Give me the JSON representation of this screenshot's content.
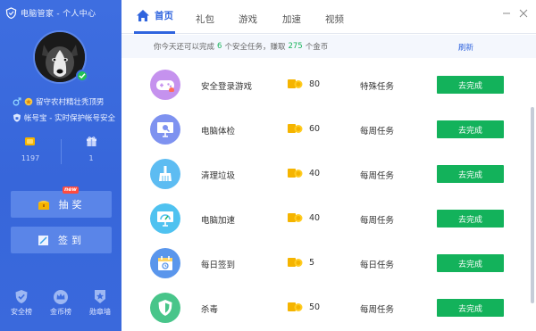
{
  "window": {
    "title": "电脑管家 - 个人中心"
  },
  "profile": {
    "nickname": "留守农村精壮秃顶男",
    "account_info": "帐号宝 - 实时保护帐号安全",
    "stats": [
      {
        "icon": "coin-stack-icon",
        "value": "1197"
      },
      {
        "icon": "gift-icon",
        "value": "1"
      }
    ],
    "lottery_label": "抽奖",
    "lottery_badge": "new",
    "checkin_label": "签到"
  },
  "bottom_nav": [
    {
      "icon": "shield-check-icon",
      "label": "安全榜"
    },
    {
      "icon": "crown-icon",
      "label": "金币榜"
    },
    {
      "icon": "medal-icon",
      "label": "勋章墙"
    }
  ],
  "tabs": [
    {
      "label": "首页",
      "active": true
    },
    {
      "label": "礼包",
      "active": false
    },
    {
      "label": "游戏",
      "active": false
    },
    {
      "label": "加速",
      "active": false
    },
    {
      "label": "视频",
      "active": false
    }
  ],
  "notice": {
    "prefix": "你今天还可以完成",
    "task_count": "6",
    "middle": "个安全任务，赚取",
    "coin_count": "275",
    "suffix": "个金币",
    "refresh_label": "刷新"
  },
  "tasks": [
    {
      "icon": "gamepad-icon",
      "name": "安全登录游戏",
      "reward": "80",
      "type": "特殊任务",
      "button": "去完成",
      "color": "#c592ee"
    },
    {
      "icon": "monitor-check-icon",
      "name": "电脑体检",
      "reward": "60",
      "type": "每周任务",
      "button": "去完成",
      "color": "#7e92f0"
    },
    {
      "icon": "broom-icon",
      "name": "清理垃圾",
      "reward": "40",
      "type": "每周任务",
      "button": "去完成",
      "color": "#5dbcf2"
    },
    {
      "icon": "speed-gauge-icon",
      "name": "电脑加速",
      "reward": "40",
      "type": "每周任务",
      "button": "去完成",
      "color": "#4fc2f0"
    },
    {
      "icon": "calendar-icon",
      "name": "每日签到",
      "reward": "5",
      "type": "每日任务",
      "button": "去完成",
      "color": "#5a96ec"
    },
    {
      "icon": "antivirus-shield-icon",
      "name": "杀毒",
      "reward": "50",
      "type": "每周任务",
      "button": "去完成",
      "color": "#48c58a"
    }
  ],
  "colors": {
    "sidebar": "#3e6ee0",
    "accent": "#2f64de",
    "button_green": "#13b25b",
    "coin": "#f5b400"
  }
}
